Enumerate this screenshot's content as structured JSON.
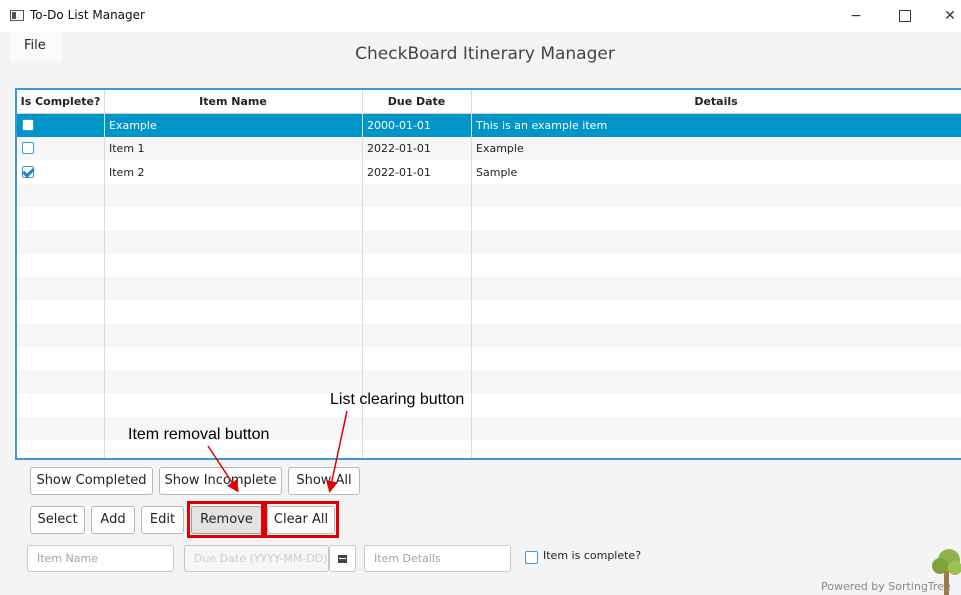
{
  "window": {
    "title": "To-Do List Manager",
    "controls": {
      "minimize": "−",
      "close": "✕"
    }
  },
  "menu": {
    "file": "File"
  },
  "app_title": "CheckBoard Itinerary Manager",
  "table": {
    "columns": [
      "Is Complete?",
      "Item Name",
      "Due Date",
      "Details"
    ],
    "rows": [
      {
        "complete": false,
        "name": "Example",
        "due": "2000-01-01",
        "details": "This is an example item",
        "selected": true
      },
      {
        "complete": false,
        "name": "Item 1",
        "due": "2022-01-01",
        "details": "Example",
        "selected": false
      },
      {
        "complete": true,
        "name": "Item 2",
        "due": "2022-01-01",
        "details": "Sample",
        "selected": false
      }
    ]
  },
  "filter_buttons": {
    "show_completed": "Show Completed",
    "show_incomplete": "Show Incomplete",
    "show_all": "Show All"
  },
  "action_buttons": {
    "select": "Select",
    "add": "Add",
    "edit": "Edit",
    "remove": "Remove",
    "clear_all": "Clear All"
  },
  "form": {
    "item_name_placeholder": "Item Name",
    "due_date_placeholder": "Due Date (YYYY-MM-DD)",
    "item_details_placeholder": "Item Details",
    "complete_label": "Item is complete?"
  },
  "annotations": {
    "remove_label": "Item removal button",
    "clear_label": "List clearing button",
    "highlight_color": "#e00000"
  },
  "footer": {
    "powered_by": "Powered by SortingTree"
  },
  "colors": {
    "accent": "#0096c9",
    "border_accent": "#3d9ad6"
  }
}
